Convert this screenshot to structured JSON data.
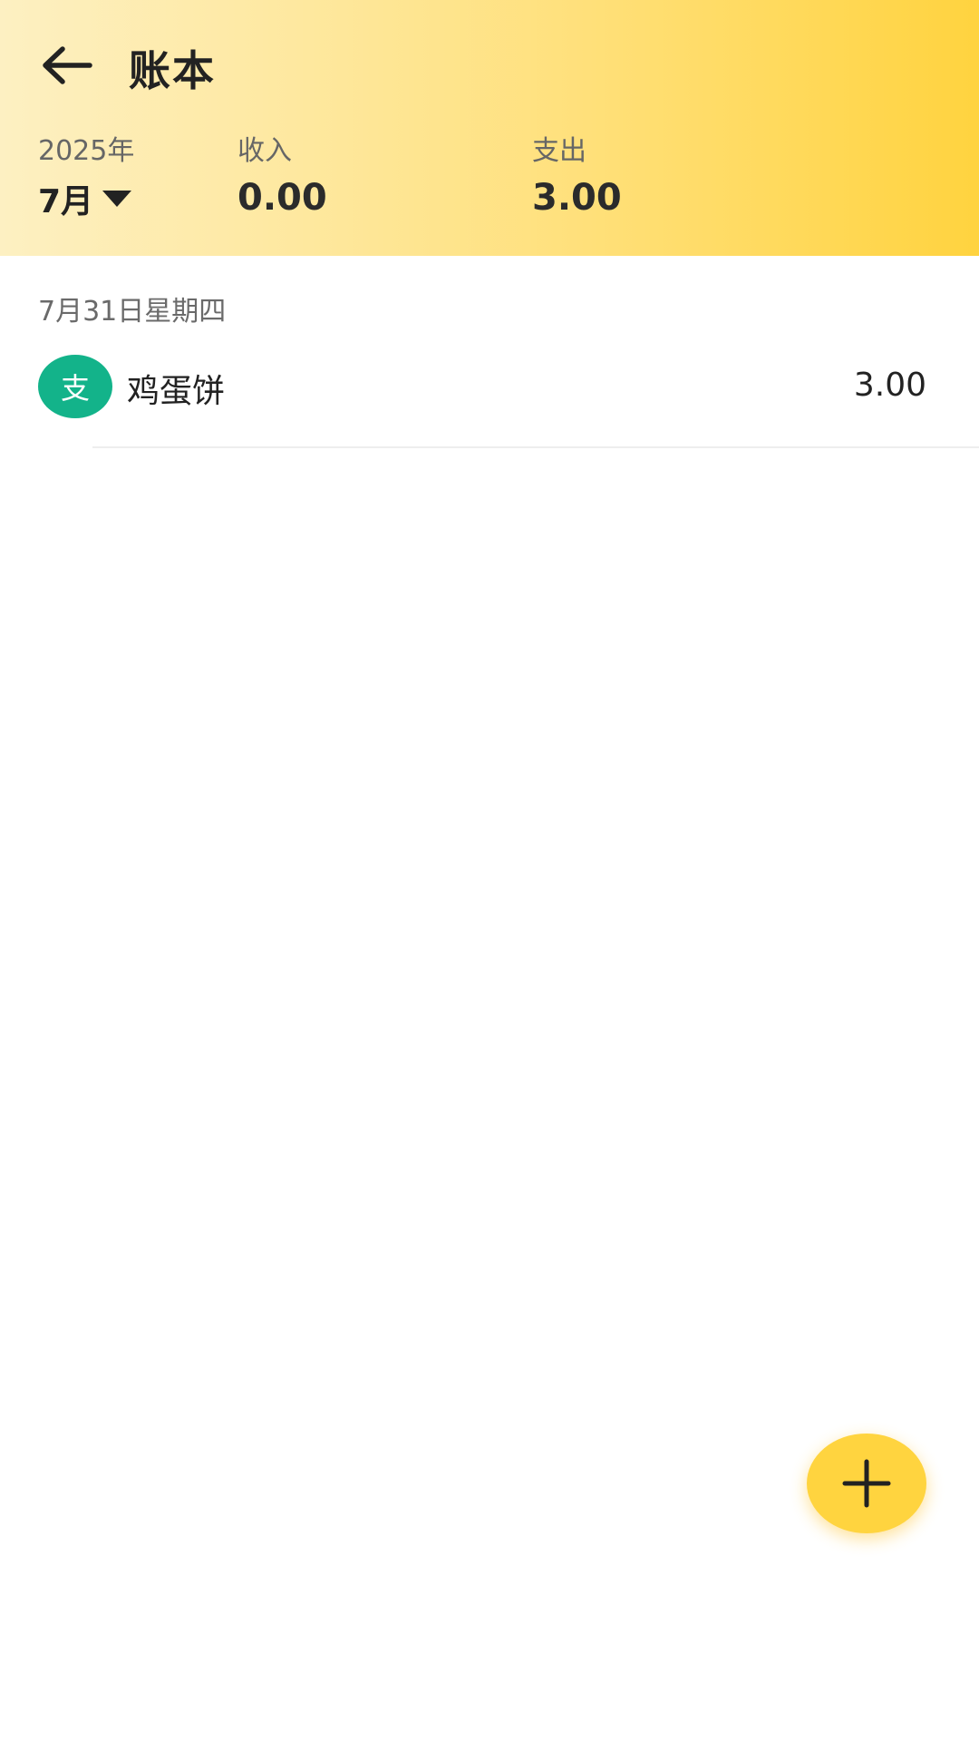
{
  "header": {
    "title": "账本",
    "back_icon": "arrow-left-icon"
  },
  "summary": {
    "year": "2025年",
    "month": "7月",
    "income_label": "收入",
    "income_value": "0.00",
    "expense_label": "支出",
    "expense_value": "3.00"
  },
  "list": {
    "date_header": "7月31日星期四",
    "entries": [
      {
        "badge": "支",
        "name": "鸡蛋饼",
        "amount": "3.00",
        "badge_color": "#13B38A"
      }
    ]
  },
  "fab": {
    "icon": "plus-icon",
    "color": "#FFD43F"
  },
  "colors": {
    "header_gradient_start": "#FDF0C2",
    "header_gradient_end": "#FFD33F"
  }
}
